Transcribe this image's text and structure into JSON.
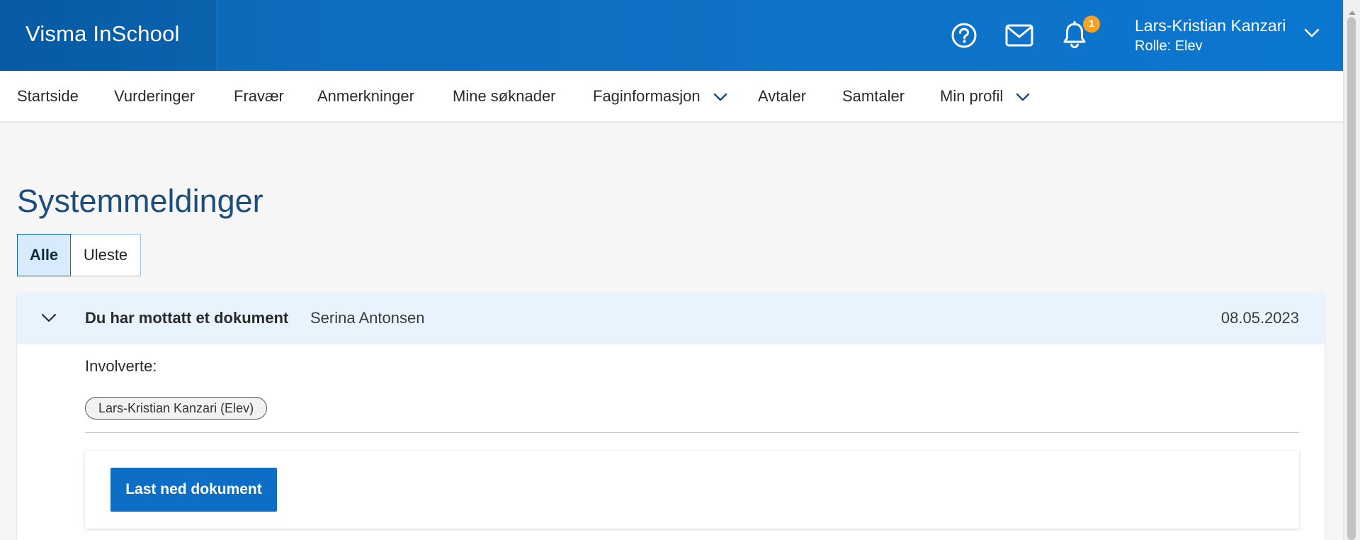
{
  "app": {
    "title": "Visma InSchool"
  },
  "header": {
    "notification_count": "1",
    "user": {
      "name": "Lars-Kristian Kanzari",
      "role": "Rolle: Elev"
    },
    "icons": [
      "help-circle-icon",
      "envelope-icon",
      "bell-icon",
      "chevron-down-icon"
    ]
  },
  "nav": {
    "items": [
      {
        "label": "Startside"
      },
      {
        "label": "Vurderinger"
      },
      {
        "label": "Fravær"
      },
      {
        "label": "Anmerkninger"
      },
      {
        "label": "Mine søknader"
      },
      {
        "label": "Faginformasjon",
        "has_dropdown": true
      },
      {
        "label": "Avtaler"
      },
      {
        "label": "Samtaler"
      },
      {
        "label": "Min profil",
        "has_dropdown": true
      }
    ]
  },
  "page": {
    "title": "Systemmeldinger",
    "filter": {
      "all": "Alle",
      "unread": "Uleste",
      "selected": "Alle"
    }
  },
  "messages": [
    {
      "title": "Du har mottatt et dokument",
      "sender": "Serina Antonsen",
      "date": "08.05.2023",
      "expanded": true,
      "involved_label": "Involverte:",
      "involved": [
        "Lars-Kristian Kanzari (Elev)"
      ],
      "action_label": "Last ned dokument"
    }
  ],
  "colors": {
    "brand": "#0b6abb",
    "accent": "#0c6fc5",
    "badge": "#f8a221",
    "heading": "#1b4e7d",
    "header_row": "#e8f3fd"
  }
}
